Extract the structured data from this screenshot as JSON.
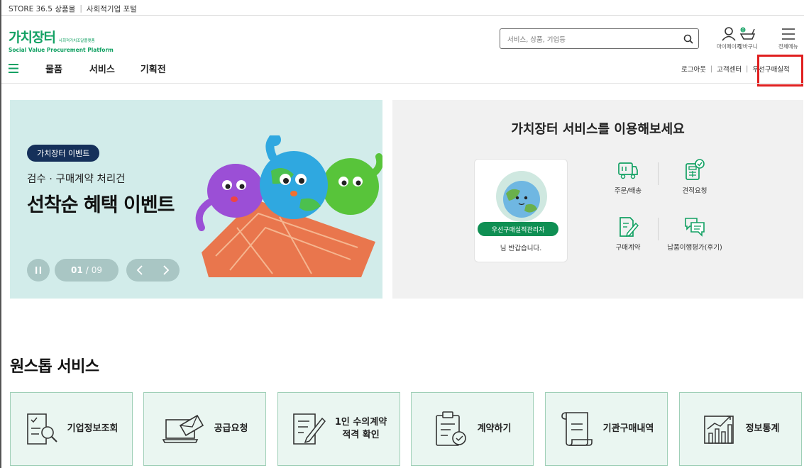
{
  "topbar": {
    "link1": "STORE 36.5 상품몰",
    "sep": "|",
    "link2": "사회적기업 포털"
  },
  "logo": {
    "title": "가치장터",
    "subtitle": "사회적가치조달플랫폼",
    "english": "Social Value Procurement Platform"
  },
  "search": {
    "placeholder": "서비스, 상품, 기업등"
  },
  "utility": {
    "mypage": "마이페이지",
    "cart": "장바구니",
    "allmenu": "전체메뉴"
  },
  "gnb": {
    "items": [
      "물품",
      "서비스",
      "기획전"
    ],
    "right": [
      "로그아웃",
      "고객센터",
      "우선구매실적"
    ],
    "sep": "|"
  },
  "banner": {
    "badge": "가치장터 이벤트",
    "subtitle": "검수 · 구매계약 처리건",
    "title": "선착순 혜택 이벤트",
    "current": "01",
    "slash": "/",
    "total": "09"
  },
  "service_panel": {
    "title": "가치장터 서비스를 이용해보세요",
    "role": "우선구매실적관리자",
    "greeting": "님 반갑습니다.",
    "items": [
      "주문/배송",
      "견적요청",
      "구매계약",
      "납품이행평가(후기)"
    ]
  },
  "onestop": {
    "title": "원스톱 서비스",
    "cards": [
      "기업정보조회",
      "공급요청",
      "1인 수의계약",
      "적격 확인",
      "계약하기",
      "기관구매내역",
      "정보통계"
    ]
  },
  "colors": {
    "brand_green": "#12a163",
    "banner_bg": "#d2ecea",
    "badge_navy": "#15305a",
    "card_bg": "#eaf6f1",
    "highlight_red": "#e02020"
  }
}
